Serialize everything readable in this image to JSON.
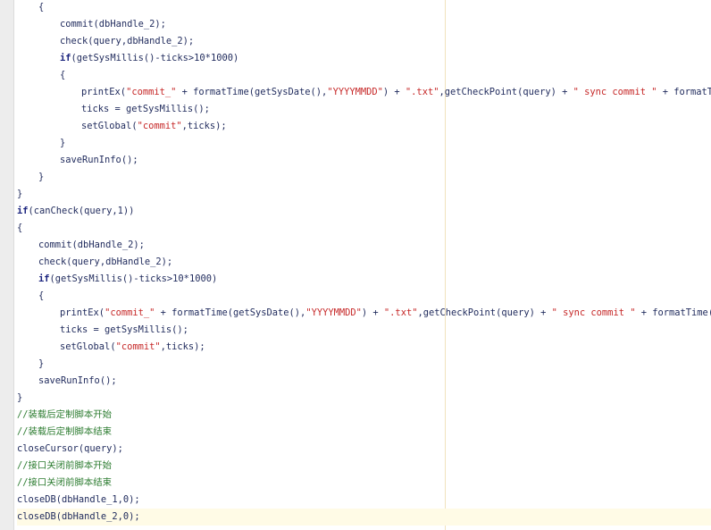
{
  "editor": {
    "lines": [
      {
        "indent": 1,
        "tokens": [
          {
            "t": "{",
            "k": "pl"
          }
        ]
      },
      {
        "indent": 2,
        "tokens": [
          {
            "t": "commit",
            "k": "fn"
          },
          {
            "t": "(dbHandle_2);",
            "k": "pl"
          }
        ]
      },
      {
        "indent": 2,
        "tokens": [
          {
            "t": "check",
            "k": "fn"
          },
          {
            "t": "(query,dbHandle_2);",
            "k": "pl"
          }
        ]
      },
      {
        "indent": 2,
        "tokens": [
          {
            "t": "if",
            "k": "kw"
          },
          {
            "t": "(",
            "k": "pl"
          },
          {
            "t": "getSysMillis",
            "k": "fn"
          },
          {
            "t": "()-ticks>",
            "k": "pl"
          },
          {
            "t": "10*1000",
            "k": "num"
          },
          {
            "t": ")",
            "k": "pl"
          }
        ]
      },
      {
        "indent": 2,
        "tokens": [
          {
            "t": "{",
            "k": "pl"
          }
        ]
      },
      {
        "indent": 3,
        "tokens": [
          {
            "t": "printEx",
            "k": "fn"
          },
          {
            "t": "(",
            "k": "pl"
          },
          {
            "t": "\"commit_\"",
            "k": "str"
          },
          {
            "t": " + ",
            "k": "pl"
          },
          {
            "t": "formatTime",
            "k": "fn"
          },
          {
            "t": "(",
            "k": "pl"
          },
          {
            "t": "getSysDate",
            "k": "fn"
          },
          {
            "t": "(),",
            "k": "pl"
          },
          {
            "t": "\"YYYYMMDD\"",
            "k": "str"
          },
          {
            "t": ") + ",
            "k": "pl"
          },
          {
            "t": "\".txt\"",
            "k": "str"
          },
          {
            "t": ",",
            "k": "pl"
          },
          {
            "t": "getCheckPoint",
            "k": "fn"
          },
          {
            "t": "(query) + ",
            "k": "pl"
          },
          {
            "t": "\" sync commit \"",
            "k": "str"
          },
          {
            "t": " + ",
            "k": "pl"
          },
          {
            "t": "formatTime",
            "k": "fn"
          },
          {
            "t": "(",
            "k": "pl"
          }
        ]
      },
      {
        "indent": 3,
        "tokens": [
          {
            "t": "ticks = ",
            "k": "pl"
          },
          {
            "t": "getSysMillis",
            "k": "fn"
          },
          {
            "t": "();",
            "k": "pl"
          }
        ]
      },
      {
        "indent": 3,
        "tokens": [
          {
            "t": "setGlobal",
            "k": "fn"
          },
          {
            "t": "(",
            "k": "pl"
          },
          {
            "t": "\"commit\"",
            "k": "str"
          },
          {
            "t": ",ticks);",
            "k": "pl"
          }
        ]
      },
      {
        "indent": 2,
        "tokens": [
          {
            "t": "}",
            "k": "pl"
          }
        ]
      },
      {
        "indent": 2,
        "tokens": [
          {
            "t": "saveRunInfo",
            "k": "fn"
          },
          {
            "t": "();",
            "k": "pl"
          }
        ]
      },
      {
        "indent": 1,
        "tokens": [
          {
            "t": "}",
            "k": "pl"
          }
        ]
      },
      {
        "indent": 0,
        "tokens": [
          {
            "t": "}",
            "k": "pl"
          }
        ]
      },
      {
        "indent": 0,
        "tokens": [
          {
            "t": "if",
            "k": "kw"
          },
          {
            "t": "(",
            "k": "pl"
          },
          {
            "t": "canCheck",
            "k": "fn"
          },
          {
            "t": "(query,",
            "k": "pl"
          },
          {
            "t": "1",
            "k": "num"
          },
          {
            "t": "))",
            "k": "pl"
          }
        ]
      },
      {
        "indent": 0,
        "tokens": [
          {
            "t": "{",
            "k": "pl"
          }
        ]
      },
      {
        "indent": 1,
        "tokens": [
          {
            "t": "commit",
            "k": "fn"
          },
          {
            "t": "(dbHandle_2);",
            "k": "pl"
          }
        ]
      },
      {
        "indent": 1,
        "tokens": [
          {
            "t": "check",
            "k": "fn"
          },
          {
            "t": "(query,dbHandle_2);",
            "k": "pl"
          }
        ]
      },
      {
        "indent": 1,
        "tokens": [
          {
            "t": "if",
            "k": "kw"
          },
          {
            "t": "(",
            "k": "pl"
          },
          {
            "t": "getSysMillis",
            "k": "fn"
          },
          {
            "t": "()-ticks>",
            "k": "pl"
          },
          {
            "t": "10*1000",
            "k": "num"
          },
          {
            "t": ")",
            "k": "pl"
          }
        ]
      },
      {
        "indent": 1,
        "tokens": [
          {
            "t": "{",
            "k": "pl"
          }
        ]
      },
      {
        "indent": 2,
        "tokens": [
          {
            "t": "printEx",
            "k": "fn"
          },
          {
            "t": "(",
            "k": "pl"
          },
          {
            "t": "\"commit_\"",
            "k": "str"
          },
          {
            "t": " + ",
            "k": "pl"
          },
          {
            "t": "formatTime",
            "k": "fn"
          },
          {
            "t": "(",
            "k": "pl"
          },
          {
            "t": "getSysDate",
            "k": "fn"
          },
          {
            "t": "(),",
            "k": "pl"
          },
          {
            "t": "\"YYYYMMDD\"",
            "k": "str"
          },
          {
            "t": ") + ",
            "k": "pl"
          },
          {
            "t": "\".txt\"",
            "k": "str"
          },
          {
            "t": ",",
            "k": "pl"
          },
          {
            "t": "getCheckPoint",
            "k": "fn"
          },
          {
            "t": "(query) + ",
            "k": "pl"
          },
          {
            "t": "\" sync commit \"",
            "k": "str"
          },
          {
            "t": " + ",
            "k": "pl"
          },
          {
            "t": "formatTime",
            "k": "fn"
          },
          {
            "t": "(getS",
            "k": "pl"
          }
        ]
      },
      {
        "indent": 2,
        "tokens": [
          {
            "t": "ticks = ",
            "k": "pl"
          },
          {
            "t": "getSysMillis",
            "k": "fn"
          },
          {
            "t": "();",
            "k": "pl"
          }
        ]
      },
      {
        "indent": 2,
        "tokens": [
          {
            "t": "setGlobal",
            "k": "fn"
          },
          {
            "t": "(",
            "k": "pl"
          },
          {
            "t": "\"commit\"",
            "k": "str"
          },
          {
            "t": ",ticks);",
            "k": "pl"
          }
        ]
      },
      {
        "indent": 1,
        "tokens": [
          {
            "t": "}",
            "k": "pl"
          }
        ]
      },
      {
        "indent": 1,
        "tokens": [
          {
            "t": "saveRunInfo",
            "k": "fn"
          },
          {
            "t": "();",
            "k": "pl"
          }
        ]
      },
      {
        "indent": 0,
        "tokens": [
          {
            "t": "}",
            "k": "pl"
          }
        ]
      },
      {
        "indent": 0,
        "tokens": [
          {
            "t": "//装载后定制脚本开始",
            "k": "cm"
          }
        ]
      },
      {
        "indent": 0,
        "tokens": [
          {
            "t": "//装载后定制脚本结束",
            "k": "cm"
          }
        ]
      },
      {
        "indent": 0,
        "tokens": [
          {
            "t": "closeCursor",
            "k": "fn"
          },
          {
            "t": "(query);",
            "k": "pl"
          }
        ]
      },
      {
        "indent": 0,
        "tokens": [
          {
            "t": "//接口关闭前脚本开始",
            "k": "cm"
          }
        ]
      },
      {
        "indent": 0,
        "tokens": [
          {
            "t": "//接口关闭前脚本结束",
            "k": "cm"
          }
        ]
      },
      {
        "indent": 0,
        "tokens": [
          {
            "t": "closeDB",
            "k": "fn"
          },
          {
            "t": "(dbHandle_1,",
            "k": "pl"
          },
          {
            "t": "0",
            "k": "num"
          },
          {
            "t": ");",
            "k": "pl"
          }
        ]
      },
      {
        "indent": 0,
        "tokens": [
          {
            "t": "closeDB",
            "k": "fn"
          },
          {
            "t": "(dbHandle_2,",
            "k": "pl"
          },
          {
            "t": "0",
            "k": "num"
          },
          {
            "t": ");",
            "k": "pl"
          }
        ],
        "current": true
      }
    ]
  }
}
